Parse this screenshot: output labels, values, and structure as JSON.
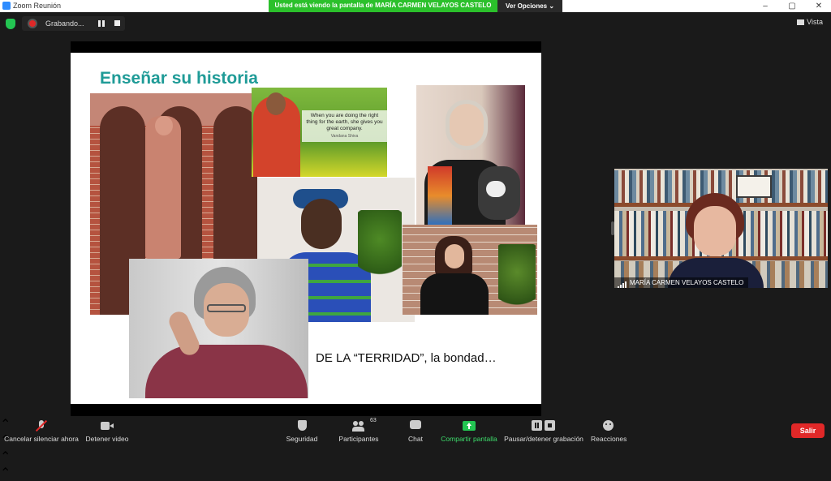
{
  "window": {
    "title": "Zoom Reunión",
    "controls": [
      "–",
      "▢",
      "✕"
    ]
  },
  "share_banner": {
    "message": "Usted está viendo la pantalla de MARÍA CARMEN VELAYOS CASTELO",
    "view_options": "Ver Opciones ⌄"
  },
  "recording": {
    "label": "Grabando..."
  },
  "view_button": {
    "label": "Vista"
  },
  "slide": {
    "title": "Enseñar su historia",
    "quote": "When you are doing the right thing for the earth, she gives you great company.",
    "quote_author": "Vandana Shiva",
    "caption": "DE LA “TERRIDAD”, la bondad…"
  },
  "participant_video": {
    "name": "MARÍA CARMEN VELAYOS CASTELO"
  },
  "toolbar": {
    "mute": "Cancelar silenciar ahora",
    "video": "Detener video",
    "security": "Seguridad",
    "participants": "Participantes",
    "participants_count": "63",
    "chat": "Chat",
    "share": "Compartir pantalla",
    "record": "Pausar/detener grabación",
    "reactions": "Reacciones",
    "leave": "Salir"
  },
  "colors": {
    "share_green": "#2bc02b",
    "accent_teal": "#1f9b97",
    "leave_red": "#e02828",
    "zoom_blue": "#2d8cff"
  }
}
